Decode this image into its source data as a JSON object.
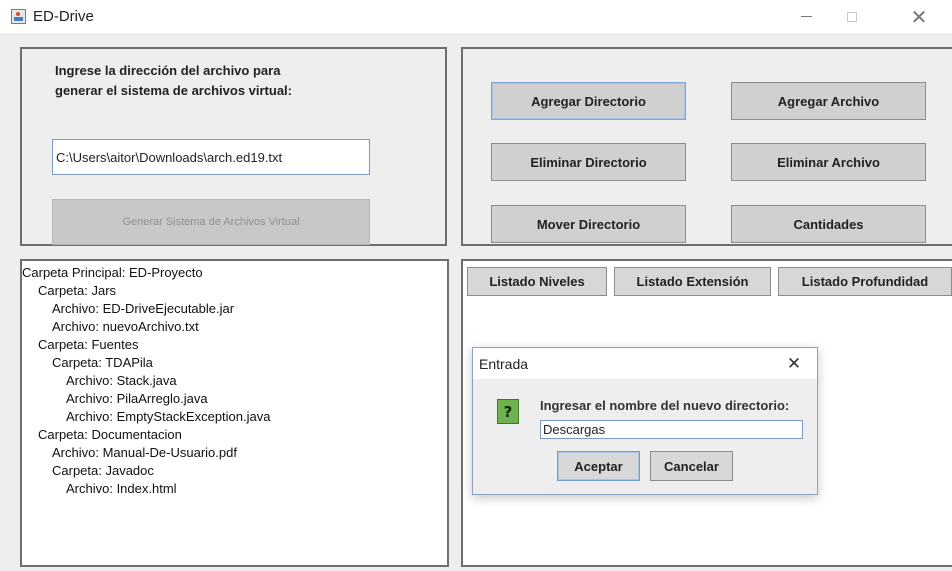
{
  "window": {
    "title": "ED-Drive",
    "controls": {
      "close_glyph": "✕"
    }
  },
  "input_panel": {
    "prompt_line1": "Ingrese la dirección del archivo para",
    "prompt_line2": "generar el sistema de archivos virtual:",
    "path_value": "C:\\Users\\aitor\\Downloads\\arch.ed19.txt",
    "generate_label": "Generar Sistema de Archivos Virtual"
  },
  "actions": {
    "agregar_directorio": "Agregar Directorio",
    "agregar_archivo": "Agregar Archivo",
    "eliminar_directorio": "Eliminar Directorio",
    "eliminar_archivo": "Eliminar Archivo",
    "mover_directorio": "Mover Directorio",
    "cantidades": "Cantidades"
  },
  "tree": {
    "lines": [
      "Carpeta Principal: ED-Proyecto",
      "Carpeta: Jars",
      "Archivo: ED-DriveEjecutable.jar",
      "Archivo: nuevoArchivo.txt",
      "Carpeta: Fuentes",
      "Carpeta: TDAPila",
      "Archivo: Stack.java",
      "Archivo: PilaArreglo.java",
      "Archivo: EmptyStackException.java",
      "Carpeta: Documentacion",
      "Archivo: Manual-De-Usuario.pdf",
      "Carpeta: Javadoc",
      "Archivo: Index.html"
    ]
  },
  "listing": {
    "niveles": "Listado Niveles",
    "extension": "Listado Extensión",
    "profundidad": "Listado Profundidad"
  },
  "dialog": {
    "title": "Entrada",
    "close_glyph": "✕",
    "icon_glyph": "?",
    "message": "Ingresar el nombre del nuevo directorio:",
    "input_value": "Descargas",
    "accept_label": "Aceptar",
    "cancel_label": "Cancelar"
  }
}
